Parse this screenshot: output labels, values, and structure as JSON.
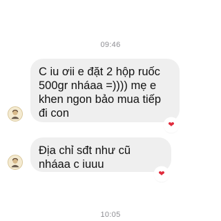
{
  "timestamps": {
    "top": "09:46",
    "bottom": "10:05"
  },
  "messages": [
    {
      "text": "C iu ơii e đặt 2 hộp ruốc 500gr nháaa =)))) mẹ e khen ngon bảo mua tiếp đi con",
      "reaction": "❤"
    },
    {
      "text": "Địa chỉ sđt như cũ nháaa c iuuu",
      "reaction": "❤"
    }
  ],
  "icons": {
    "avatar": "user-avatar-icon",
    "reaction": "heart-icon"
  },
  "colors": {
    "bubble": "#efefef",
    "timestamp": "#8e8e93",
    "heart": "#e02b3c"
  }
}
